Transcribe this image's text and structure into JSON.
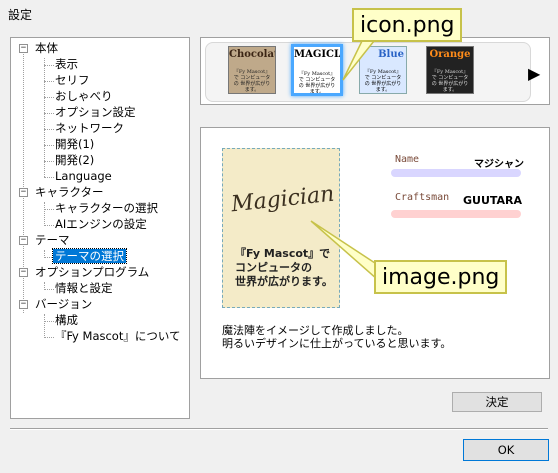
{
  "window": {
    "title": "設定"
  },
  "tree": {
    "items": [
      {
        "label": "本体"
      },
      {
        "label": "表示"
      },
      {
        "label": "セリフ"
      },
      {
        "label": "おしゃべり"
      },
      {
        "label": "オプション設定"
      },
      {
        "label": "ネットワーク"
      },
      {
        "label": "開発(1)"
      },
      {
        "label": "開発(2)"
      },
      {
        "label": "Language"
      },
      {
        "label": "キャラクター"
      },
      {
        "label": "キャラクターの選択"
      },
      {
        "label": "AIエンジンの設定"
      },
      {
        "label": "テーマ"
      },
      {
        "label": "テーマの選択"
      },
      {
        "label": "オプションプログラム"
      },
      {
        "label": "情報と設定"
      },
      {
        "label": "バージョン"
      },
      {
        "label": "構成"
      },
      {
        "label": "『Fy Mascot』について"
      }
    ],
    "expanded_glyph": "−"
  },
  "themes": {
    "items": [
      {
        "title": "Chocolate",
        "subtitle": "『Fy Mascot』で コンピュータの 世界が広がります。"
      },
      {
        "title": "MAGICIAN",
        "subtitle": "『Fy Mascot』で コンピュータの 世界が広がります。"
      },
      {
        "title": "Blue",
        "subtitle": "『Fy Mascot』で コンピュータの 世界が広がります。"
      },
      {
        "title": "Orange",
        "subtitle": "『Fy Mascot』で コンピュータの 世界が広がります。"
      }
    ],
    "scroll_arrow": "▶"
  },
  "preview": {
    "logo": "Magician",
    "card_text": "『Fy Mascot』で\nコンピュータの\n世界が広がります。",
    "name_label": "Name",
    "name_value": "マジシャン",
    "craftsman_label": "Craftsman",
    "craftsman_value": "GUUTARA",
    "description": "魔法陣をイメージして作成しました。\n明るいデザインに仕上がっていると思います。"
  },
  "callouts": {
    "icon": "icon.png",
    "image": "image.png"
  },
  "buttons": {
    "decide": "決定",
    "ok": "OK"
  },
  "colors": {
    "selection": "#0078d7",
    "callout_bg": "#ffffc8",
    "callout_border": "#c7c24a"
  }
}
